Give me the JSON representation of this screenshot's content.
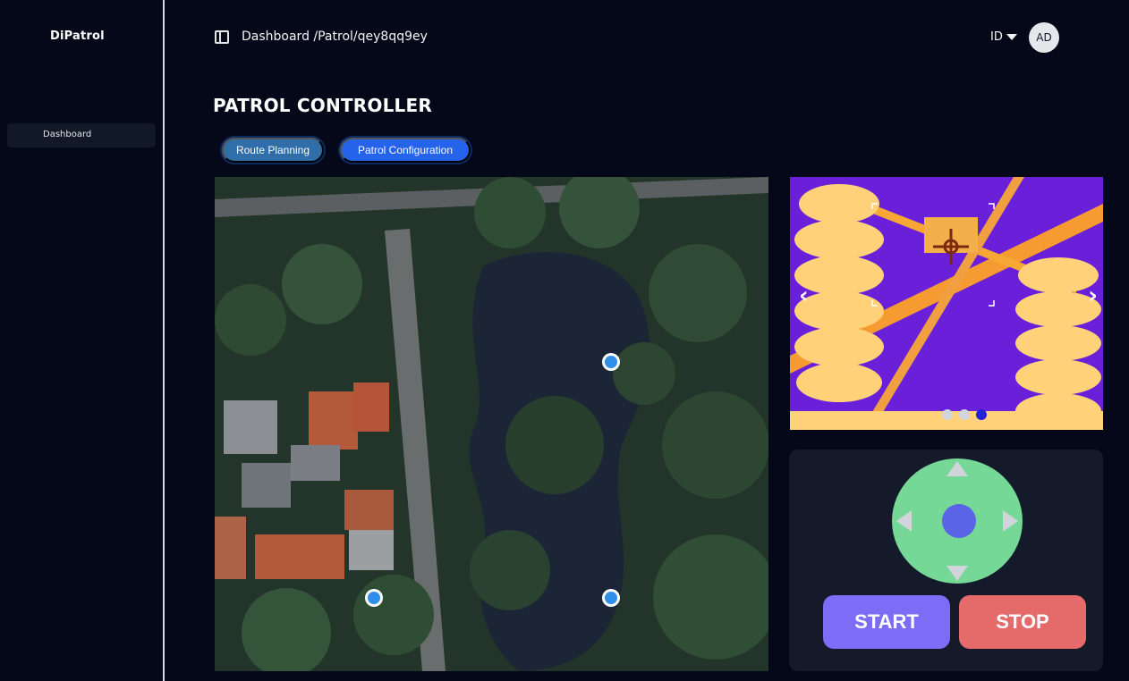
{
  "app": {
    "brand": "DiPatrol"
  },
  "sidebar": {
    "items": [
      {
        "label": "Dashboard"
      }
    ]
  },
  "header": {
    "breadcrumb": "Dashboard /Patrol/qey8qq9ey",
    "language": "ID",
    "avatar_initials": "AD"
  },
  "page": {
    "title": "PATROL CONTROLLER"
  },
  "tabs": [
    {
      "label": "Route Planning"
    },
    {
      "label": "Patrol Configuration"
    }
  ],
  "camera": {
    "prev_icon": "‹",
    "next_icon": "›",
    "slide_count": 3,
    "active_slide": 3
  },
  "controls": {
    "start_label": "START",
    "stop_label": "STOP"
  },
  "colors": {
    "background": "#050818",
    "tab_route": "#2f6ea8",
    "tab_config": "#2563eb",
    "joystick": "#76d896",
    "joystick_knob": "#5b63e6",
    "start": "#7c6cf6",
    "stop": "#e56b6b",
    "waypoint": "#2f8ee8"
  },
  "icons": {
    "sidebar_toggle": "panel-left-icon",
    "language_caret": "caret-down-icon",
    "map_waypoint": "waypoint-marker-icon"
  }
}
